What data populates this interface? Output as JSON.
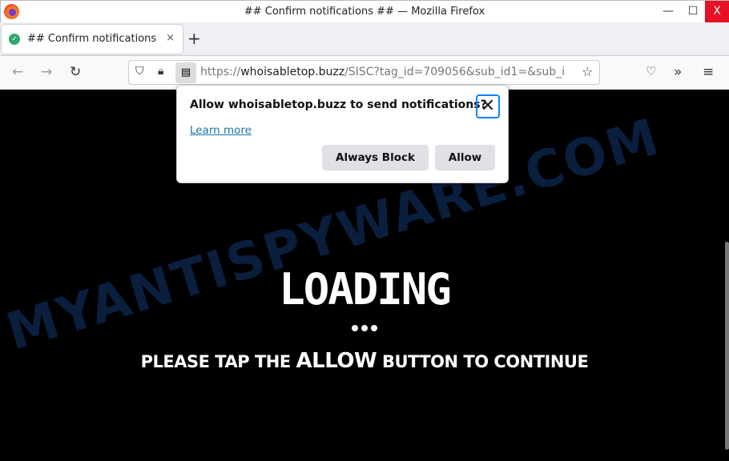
{
  "window": {
    "title": "## Confirm notifications ## — Mozilla Firefox",
    "minimize": "—",
    "maximize": "☐",
    "close": "X"
  },
  "tab": {
    "title": "## Confirm notifications",
    "close": "×",
    "new_tab": "+"
  },
  "nav": {
    "url_domain": "whoisabletop.buzz",
    "url_prefix": "https://",
    "url_path": "/SISC?tag_id=709056&sub_id1=&sub_i"
  },
  "popup": {
    "question": "Allow whoisabletop.buzz to send notifications?",
    "learn_more": "Learn more",
    "block": "Always Block",
    "allow": "Allow",
    "close": "✕"
  },
  "page": {
    "loading": "LOADING",
    "tap_before": "PLEASE TAP THE ",
    "tap_allow": "ALLOW",
    "tap_after": " BUTTON TO CONTINUE"
  },
  "watermark": "MYANTISPYWARE.COM"
}
